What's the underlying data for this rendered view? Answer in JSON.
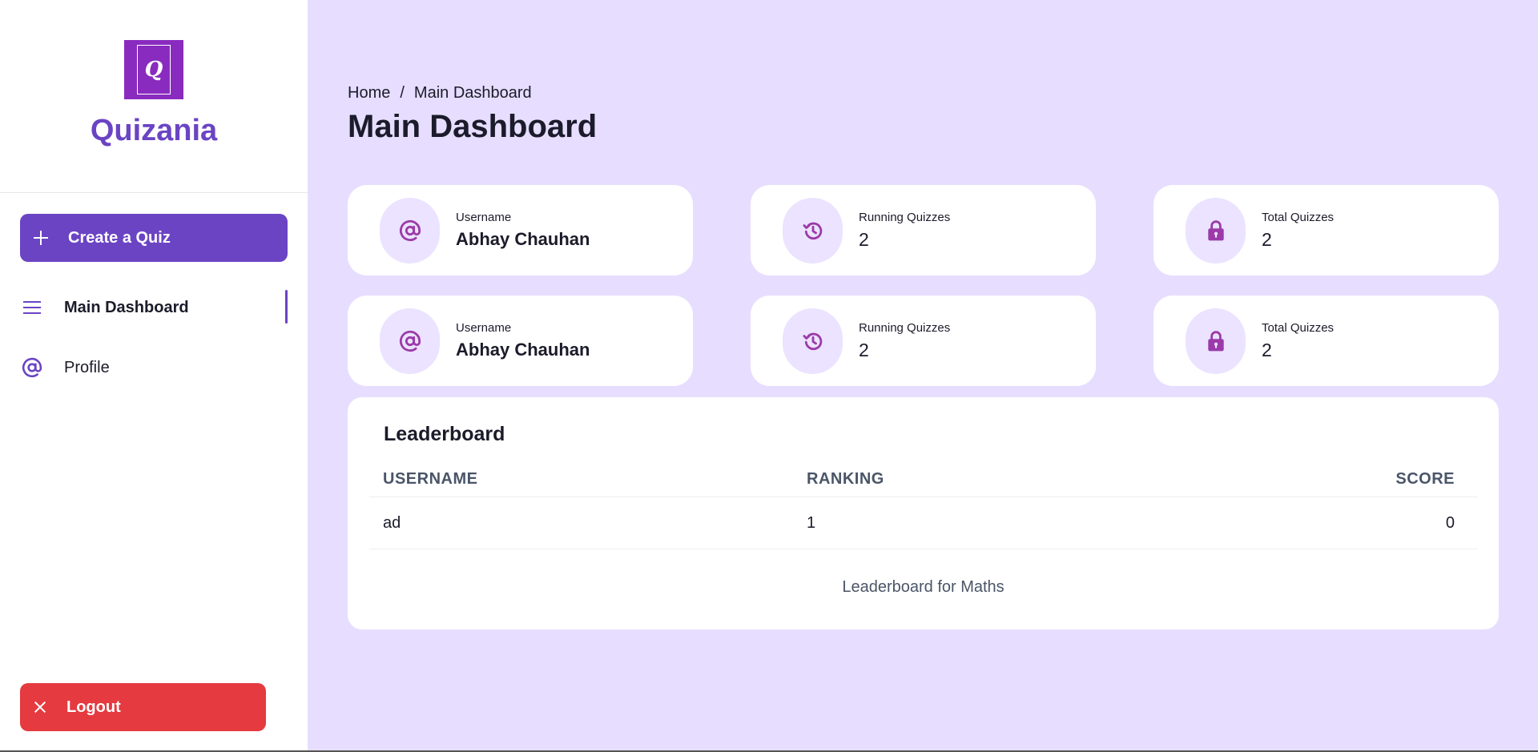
{
  "brand": {
    "logo_letter": "Q",
    "name": "Quizania"
  },
  "sidebar": {
    "create_label": "Create a Quiz",
    "items": [
      {
        "label": "Main Dashboard",
        "icon": "menu-icon",
        "active": true
      },
      {
        "label": "Profile",
        "icon": "at-sign-icon",
        "active": false
      }
    ],
    "logout_label": "Logout"
  },
  "breadcrumb": {
    "home": "Home",
    "separator": "/",
    "current": "Main Dashboard"
  },
  "page_title": "Main Dashboard",
  "stats": [
    {
      "label": "Username",
      "value": "Abhay Chauhan",
      "icon": "at-sign-icon"
    },
    {
      "label": "Running Quizzes",
      "value": "2",
      "icon": "history-icon"
    },
    {
      "label": "Total Quizzes",
      "value": "2",
      "icon": "lock-icon"
    },
    {
      "label": "Username",
      "value": "Abhay Chauhan",
      "icon": "at-sign-icon"
    },
    {
      "label": "Running Quizzes",
      "value": "2",
      "icon": "history-icon"
    },
    {
      "label": "Total Quizzes",
      "value": "2",
      "icon": "lock-icon"
    }
  ],
  "leaderboard": {
    "title": "Leaderboard",
    "columns": [
      "USERNAME",
      "RANKING",
      "SCORE"
    ],
    "rows": [
      {
        "username": "ad",
        "ranking": "1",
        "score": "0"
      }
    ],
    "caption": "Leaderboard for Maths"
  },
  "colors": {
    "accent": "#6b44c4",
    "logo_bg": "#8a2bbf",
    "danger": "#e53a3f",
    "page_bg": "#e7deff",
    "icon_color": "#9b3aa8"
  }
}
